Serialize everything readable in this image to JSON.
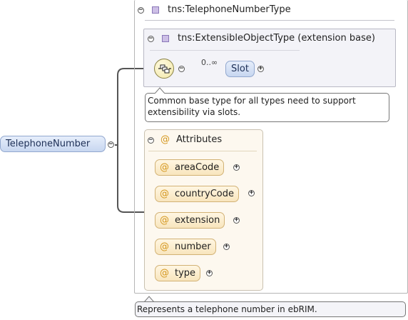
{
  "root": {
    "element_label": "TelephoneNumber"
  },
  "complex_type": {
    "title": "tns:TelephoneNumberType"
  },
  "extension": {
    "title": "tns:ExtensibleObjectType (extension base)",
    "occurrence": "0..∞",
    "child_label": "Slot",
    "documentation": "Common base type for all types need to support extensibility via slots."
  },
  "attributes": {
    "title": "Attributes",
    "symbol": "@",
    "items": [
      {
        "label": "areaCode"
      },
      {
        "label": "countryCode"
      },
      {
        "label": "extension"
      },
      {
        "label": "number"
      },
      {
        "label": "type"
      }
    ]
  },
  "type_documentation": "Represents a telephone number in ebRIM.",
  "icons": {
    "collapse": "collapse-toggle-icon",
    "expand": "expand-toggle-icon",
    "sequence": "sequence-compositor-icon",
    "complex_type": "complex-type-icon",
    "attribute": "attribute-at-icon"
  },
  "colors": {
    "element_fill": "#c7d6f0",
    "attribute_fill": "#f8e5bd",
    "attribute_symbol": "#d4961c",
    "type_icon": "#cdbfe6"
  }
}
